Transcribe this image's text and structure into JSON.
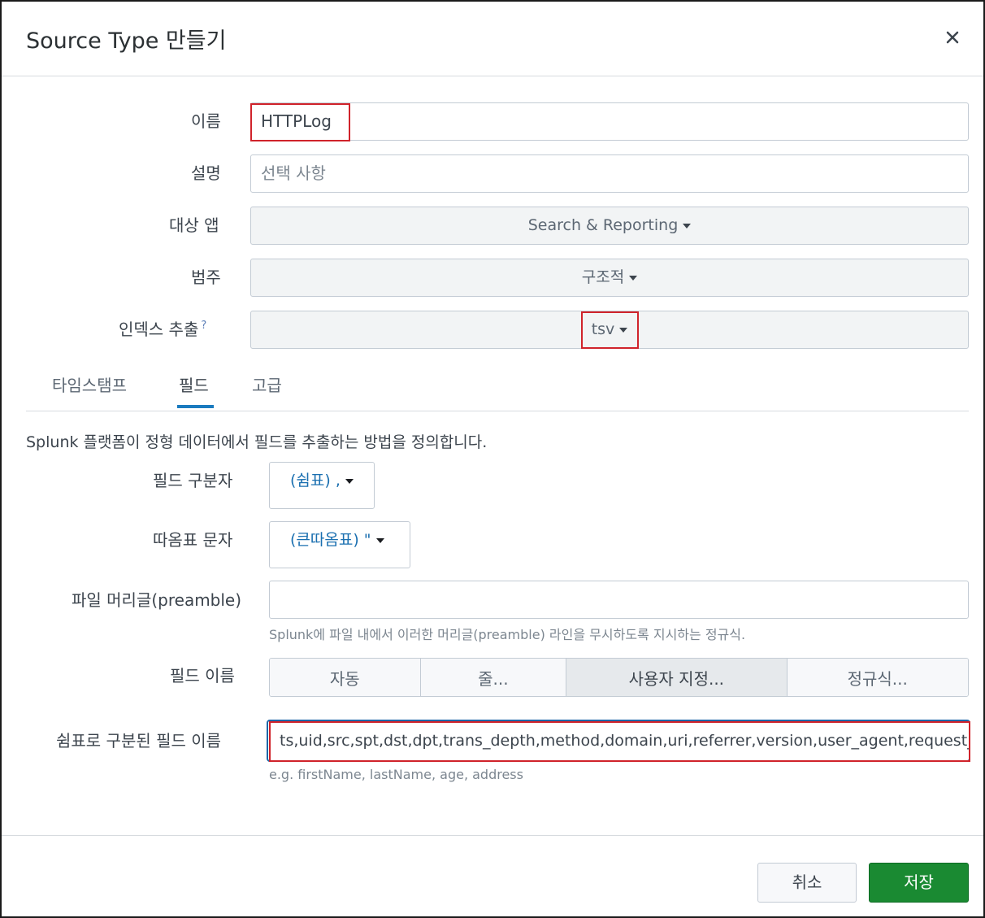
{
  "dialog": {
    "title": "Source Type 만들기",
    "close_icon": "close-icon"
  },
  "form": {
    "name": {
      "label": "이름",
      "value": "HTTPLog"
    },
    "description": {
      "label": "설명",
      "placeholder": "선택 사항"
    },
    "target_app": {
      "label": "대상 앱",
      "value": "Search & Reporting"
    },
    "category": {
      "label": "범주",
      "value": "구조적"
    },
    "index_extraction": {
      "label": "인덱스 추출",
      "help": "?",
      "value": "tsv"
    }
  },
  "tabs": [
    {
      "label": "타임스탬프"
    },
    {
      "label": "필드"
    },
    {
      "label": "고급"
    }
  ],
  "fields_tab": {
    "description": "Splunk 플랫폼이 정형 데이터에서 필드를 추출하는 방법을 정의합니다.",
    "field_delimiter": {
      "label": "필드 구분자",
      "value": "(쉼표) ,"
    },
    "quote_character": {
      "label": "따옴표 문자",
      "value": "(큰따옴표) \""
    },
    "preamble": {
      "label": "파일 머리글(preamble)",
      "value": "",
      "hint": "Splunk에 파일 내에서 이러한 머리글(preamble) 라인을 무시하도록 지시하는 정규식."
    },
    "field_names": {
      "label": "필드 이름",
      "options": [
        "자동",
        "줄...",
        "사용자 지정...",
        "정규식..."
      ],
      "selected": "사용자 지정..."
    },
    "comma_field_names": {
      "label": "쉼표로 구분된 필드 이름",
      "value": "ts,uid,src,spt,dst,dpt,trans_depth,method,domain,uri,referrer,version,user_agent,request_b",
      "hint": "e.g. firstName, lastName, age, address"
    }
  },
  "footer": {
    "cancel_label": "취소",
    "save_label": "저장"
  },
  "colors": {
    "save_button": "#1a8a32",
    "active_tab_underline": "#1a7bbf",
    "highlight_box": "#d0232b",
    "focus_border": "#1d66a8"
  }
}
